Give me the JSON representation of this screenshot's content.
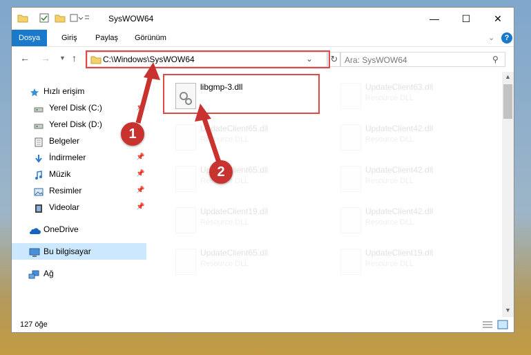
{
  "window": {
    "title": "SysWOW64"
  },
  "ribbon": {
    "tabs": [
      "Dosya",
      "Giriş",
      "Paylaş",
      "Görünüm"
    ]
  },
  "address": {
    "path": "C:\\Windows\\SysWOW64"
  },
  "search": {
    "placeholder": "Ara: SysWOW64"
  },
  "sidebar": {
    "items": [
      {
        "label": "Hızlı erişim"
      },
      {
        "label": "Yerel Disk (C:)"
      },
      {
        "label": "Yerel Disk (D:)"
      },
      {
        "label": "Belgeler"
      },
      {
        "label": "İndirmeler"
      },
      {
        "label": "Müzik"
      },
      {
        "label": "Resimler"
      },
      {
        "label": "Videolar"
      },
      {
        "label": "OneDrive"
      },
      {
        "label": "Bu bilgisayar"
      },
      {
        "label": "Ağ"
      }
    ]
  },
  "files": {
    "highlighted": {
      "name": "libgmp-3.dll",
      "type": ""
    },
    "list": [
      {
        "name": "UpdateClient63.dll",
        "type": "Resource DLL"
      },
      {
        "name": "UpdateClient65.dll",
        "type": "Resource DLL"
      },
      {
        "name": "UpdateClient42.dll",
        "type": "Resource DLL"
      },
      {
        "name": "UpdateClient65.dll",
        "type": "Resource DLL"
      },
      {
        "name": "UpdateClient42.dll",
        "type": "Resource DLL"
      },
      {
        "name": "UpdateClient19.dll",
        "type": "Resource DLL"
      },
      {
        "name": "UpdateClient42.dll",
        "type": "Resource DLL"
      },
      {
        "name": "UpdateClient65.dll",
        "type": "Resource DLL"
      },
      {
        "name": "UpdateClient19.dll",
        "type": "Resource DLL"
      }
    ]
  },
  "status": {
    "count": "127 öğe"
  },
  "callouts": {
    "one": "1",
    "two": "2"
  },
  "colors": {
    "accent": "#1979ca",
    "highlight": "#e04848",
    "callout": "#c8322f",
    "selected": "#cce8ff"
  }
}
